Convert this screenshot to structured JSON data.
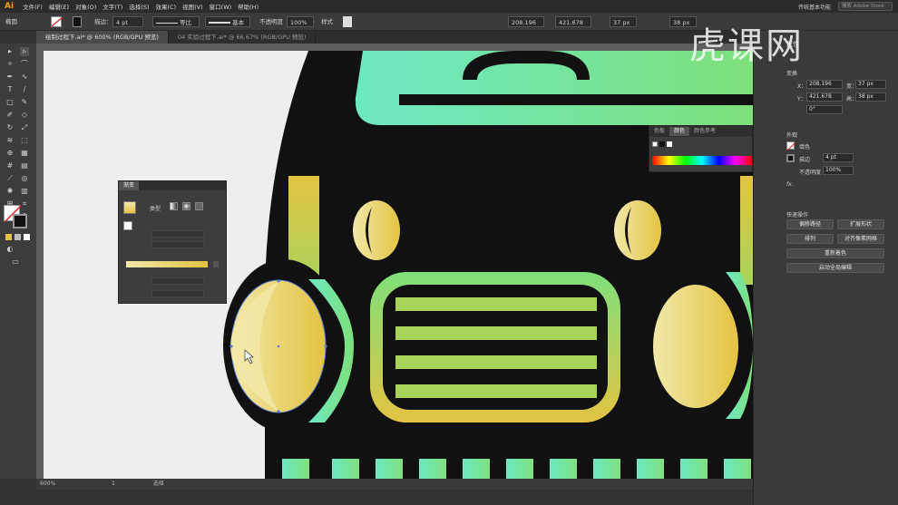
{
  "app": {
    "logo": "Ai"
  },
  "menubar": {
    "items": [
      "文件(F)",
      "编辑(E)",
      "对象(O)",
      "文字(T)",
      "选择(S)",
      "效果(C)",
      "视图(V)",
      "窗口(W)",
      "帮助(H)"
    ],
    "workspace": "传统基本功能",
    "search_placeholder": "搜索 Adobe Stock"
  },
  "controlbar": {
    "selection_label": "椭圆",
    "stroke_label": "描边：",
    "stroke_value": "4 pt",
    "profile_label": "等比",
    "brush_label": "基本",
    "opacity_label": "不透明度",
    "opacity_value": "100%",
    "style_label": "样式",
    "x_value": "208.196",
    "y_value": "421.678",
    "w_value": "37 px",
    "h_value": "38 px"
  },
  "tabs": [
    {
      "label": "绘制过程下.ai* @ 600% (RGB/GPU 预览)",
      "active": true
    },
    {
      "label": "04 实验过程下.ai* @ 66.67% (RGB/GPU 预览)",
      "active": false
    }
  ],
  "statusbar": {
    "zoom": "600%",
    "page": "1",
    "selection": "选择"
  },
  "gradient_panel": {
    "title": "渐变",
    "type_label": "类型",
    "stop_color_a": "#f2e8a8",
    "stop_color_b": "#e3c342"
  },
  "color_panel": {
    "tabs": [
      "色板",
      "颜色",
      "颜色参考"
    ]
  },
  "right_panel": {
    "title": "属性",
    "section_transform": "变换",
    "x_label": "X：",
    "x_value": "208.196",
    "y_label": "Y：",
    "y_value": "421.678",
    "w_label": "宽：",
    "w_value": "37 px",
    "h_label": "高：",
    "h_value": "38 px",
    "angle_value": "0°",
    "section_appearance": "外观",
    "fill_label": "填色",
    "stroke_label": "描边",
    "stroke_value": "4 pt",
    "opacity_label": "不透明度",
    "opacity_value": "100%",
    "fx_label": "fx.",
    "section_quick": "快速操作",
    "btn_offset": "偏移路径",
    "btn_expand": "扩展形状",
    "btn_arrange": "排列",
    "btn_align": "对齐像素网格",
    "btn_recolor": "重新着色",
    "btn_start_global": "启动全局编辑"
  },
  "watermark": "虎课网",
  "colors": {
    "artboard_bg": "#eeeeee",
    "car_black": "#111111",
    "mint": "#6ce8c4",
    "green": "#7ee07a",
    "yellow": "#e3c342",
    "light_yellow": "#f2e8a8",
    "grille_green": "#a8d45a"
  }
}
